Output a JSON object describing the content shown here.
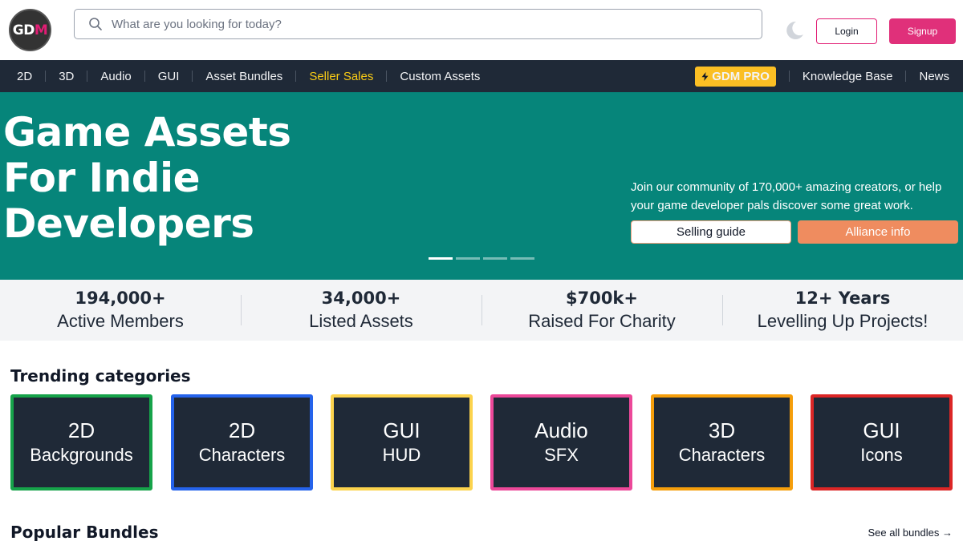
{
  "header": {
    "logo_text": "GDM",
    "search_placeholder": "What are you looking for today?",
    "login_label": "Login",
    "signup_label": "Signup",
    "theme_icon": "moon-icon"
  },
  "nav": {
    "items": [
      {
        "label": "2D"
      },
      {
        "label": "3D"
      },
      {
        "label": "Audio"
      },
      {
        "label": "GUI"
      },
      {
        "label": "Asset Bundles"
      },
      {
        "label": "Seller Sales"
      },
      {
        "label": "Custom Assets"
      }
    ],
    "pro_label": "GDM PRO",
    "right_items": [
      {
        "label": "Knowledge Base"
      },
      {
        "label": "News"
      }
    ],
    "highlight_color": "#facc15"
  },
  "hero": {
    "title_lines": [
      "Game Assets",
      "For Indie",
      "Developers"
    ],
    "description": "Join our community of 170,000+ amazing creators, or help your game developer pals discover some great work.",
    "guide_label": "Selling guide",
    "alliance_label": "Alliance info",
    "background_color": "#06857a",
    "slides_total": 4,
    "slide_active": 1
  },
  "stats": [
    {
      "value": "194,000+",
      "label": "Active Members"
    },
    {
      "value": "34,000+",
      "label": "Listed Assets"
    },
    {
      "value": "$700k+",
      "label": "Raised For Charity"
    },
    {
      "value": "12+ Years",
      "label": "Levelling Up Projects!"
    }
  ],
  "trending": {
    "title": "Trending categories",
    "categories": [
      {
        "line1": "2D",
        "line2": "Backgrounds",
        "color": "#16a34a"
      },
      {
        "line1": "2D",
        "line2": "Characters",
        "color": "#2563eb"
      },
      {
        "line1": "GUI",
        "line2": "HUD",
        "color": "#fcd34d"
      },
      {
        "line1": "Audio",
        "line2": "SFX",
        "color": "#ec4899"
      },
      {
        "line1": "3D",
        "line2": "Characters",
        "color": "#f59e0b"
      },
      {
        "line1": "GUI",
        "line2": "Icons",
        "color": "#dc2626"
      }
    ]
  },
  "popular": {
    "title": "Popular Bundles",
    "see_all_label": "See all bundles →"
  }
}
